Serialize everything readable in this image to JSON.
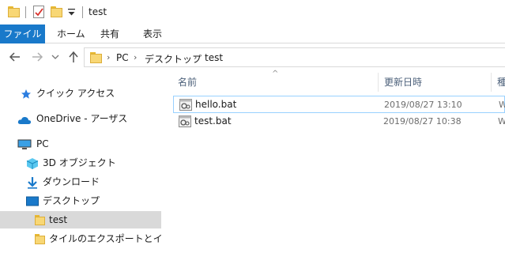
{
  "window": {
    "title": "test"
  },
  "ribbon": {
    "file_label": "ファイル",
    "tabs": [
      "ホーム",
      "共有",
      "表示"
    ]
  },
  "address": {
    "crumbs": [
      "PC",
      "デスクトップ",
      "test"
    ]
  },
  "navpane": {
    "items": [
      {
        "label": "クイック アクセス",
        "icon": "quick-access-star-icon"
      },
      {
        "label": "OneDrive - アーザス",
        "icon": "onedrive-cloud-icon"
      },
      {
        "label": "PC",
        "icon": "pc-monitor-icon"
      },
      {
        "label": "3D オブジェクト",
        "icon": "3d-objects-icon"
      },
      {
        "label": "ダウンロード",
        "icon": "download-arrow-icon"
      },
      {
        "label": "デスクトップ",
        "icon": "desktop-icon"
      },
      {
        "label": "test",
        "icon": "folder-icon",
        "selected": true
      },
      {
        "label": "タイルのエクスポートとインポート",
        "icon": "folder-icon"
      }
    ]
  },
  "content": {
    "columns": {
      "name": "名前",
      "modified": "更新日時",
      "type": "種"
    },
    "files": [
      {
        "name": "hello.bat",
        "modified": "2019/08/27 13:10",
        "type": "W"
      },
      {
        "name": "test.bat",
        "modified": "2019/08/27 10:38",
        "type": "W"
      }
    ]
  },
  "colors": {
    "file_tab": "#1979ca",
    "selection": "#d9d9d9",
    "focus_border": "#99d1ff",
    "folder": "#f8d775"
  }
}
